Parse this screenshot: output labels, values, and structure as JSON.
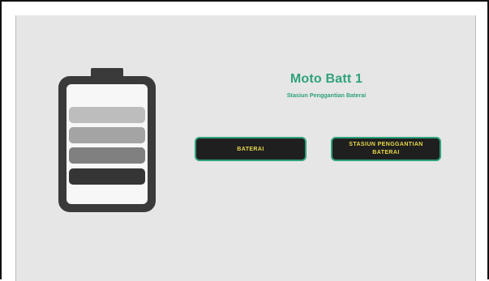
{
  "colors": {
    "accent": "#2fa27d",
    "button_bg": "#1f1f1f",
    "button_text": "#e8d84a",
    "panel_bg": "#e6e6e6"
  },
  "header": {
    "title": "Moto Batt 1",
    "subtitle": "Stasiun  Penggantian Baterai"
  },
  "buttons": {
    "baterai_label": "BATERAI",
    "stasiun_label": "STASIUN PENGGANTIAN BATERAI"
  },
  "battery_icon": {
    "icon": "battery-icon",
    "segments": 4
  }
}
